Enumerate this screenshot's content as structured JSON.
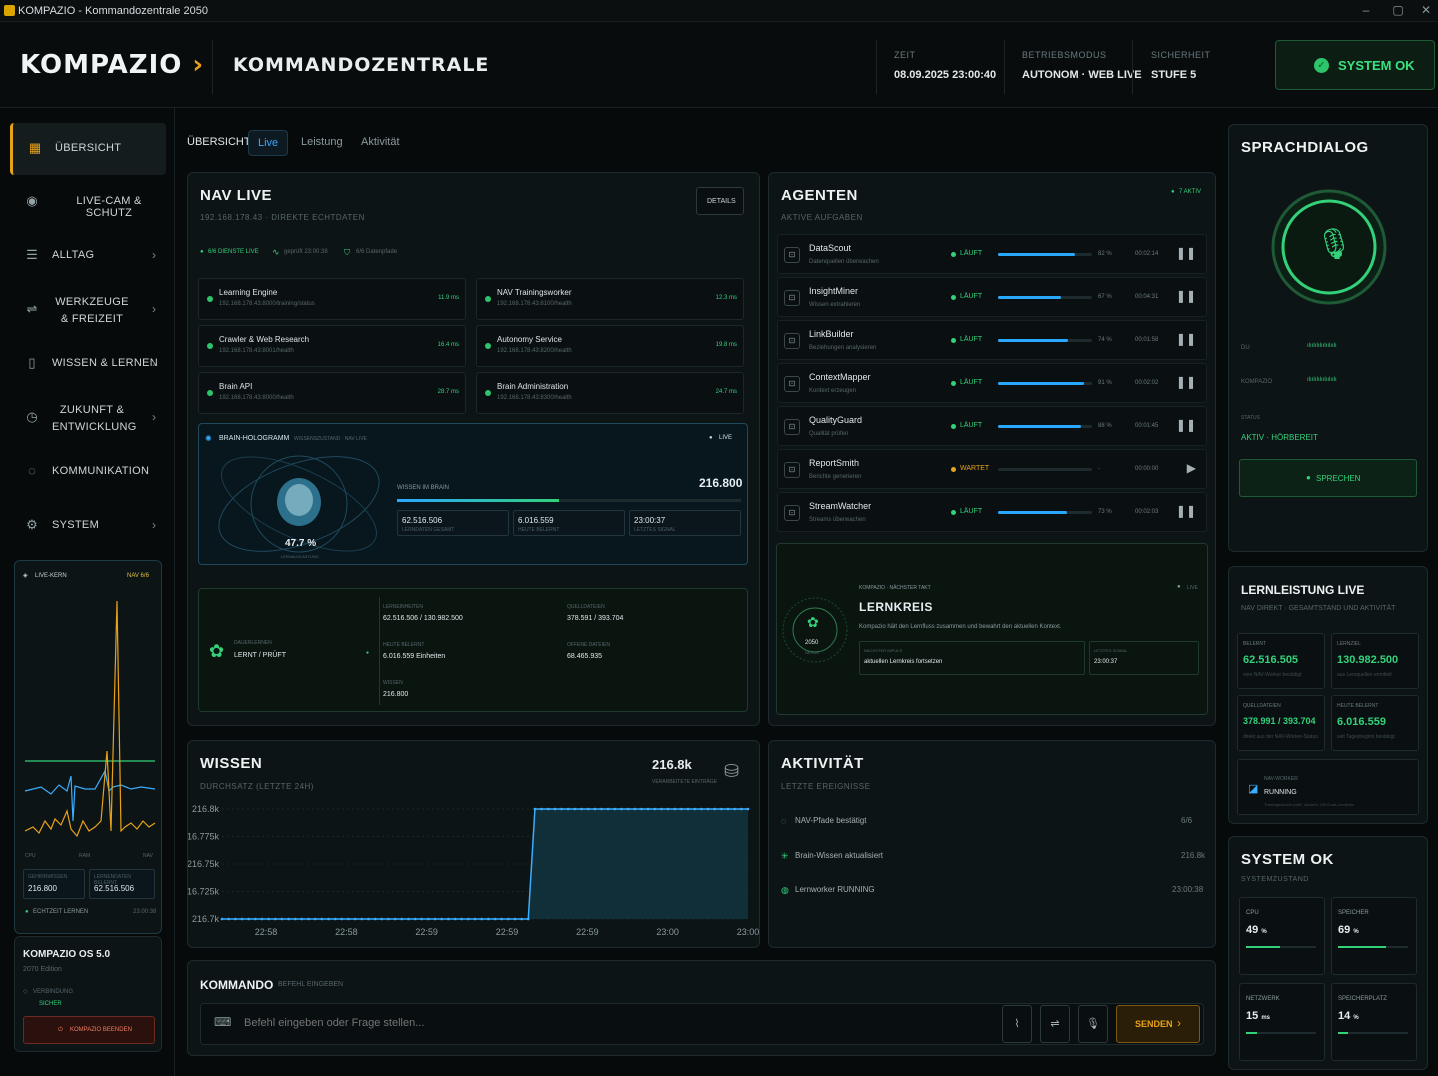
{
  "window": {
    "title": "KOMPAZIO - Kommandozentrale 2050",
    "min": "–",
    "max": "▢",
    "close": "✕"
  },
  "header": {
    "brand": "KOMPAZIO",
    "brand_chevron": "›",
    "page_title": "KOMMANDOZENTRALE",
    "zeit_label": "ZEIT",
    "zeit_value": "08.09.2025 23:00:40",
    "modus_label": "BETRIEBSMODUS",
    "modus_value": "AUTONOM · WEB LIVE",
    "sicherheit_label": "SICHERHEIT",
    "sicherheit_value": "STUFE 5",
    "status_badge": "SYSTEM OK"
  },
  "sidebar": {
    "items": [
      {
        "label": "ÜBERSICHT",
        "icon": "grid-icon"
      },
      {
        "label": "LIVE-CAM & SCHUTZ",
        "icon": "eye-icon"
      },
      {
        "label": "ALLTAG",
        "icon": "list-icon"
      },
      {
        "label": "WERKZEUGE & FREIZEIT",
        "icon": "sliders-icon"
      },
      {
        "label": "WISSEN & LERNEN",
        "icon": "book-icon"
      },
      {
        "label": "ZUKUNFT & ENTWICKLUNG",
        "icon": "clock-icon"
      },
      {
        "label": "KOMMUNIKATION",
        "icon": "chat-icon"
      },
      {
        "label": "SYSTEM",
        "icon": "gear-icon"
      }
    ],
    "livekern": {
      "title": "LIVE-KERN",
      "status": "NAV 6/6",
      "axis": [
        "CPU",
        "RAM",
        "NAV"
      ],
      "left_label": "GEHIRNWISSEN",
      "left_value": "216.800",
      "right_label": "LERNENDATEN BELERNT",
      "right_value": "62.516.506",
      "footer_left": "ECHTZEIT LERNEN",
      "footer_right": "23:00:38"
    },
    "os": {
      "title": "KOMPAZIO OS 5.0",
      "edition": "2070 Edition",
      "conn_label": "VERBINDUNG",
      "conn_value": "SICHER",
      "exit_button": "KOMPAZIO BEENDEN"
    }
  },
  "tabs": {
    "section": "ÜBERSICHT",
    "items": [
      "Live",
      "Leistung",
      "Aktivität"
    ],
    "active": "Live"
  },
  "navlive": {
    "title": "NAV LIVE",
    "subtitle": "192.168.178.43 · DIREKTE ECHTDATEN",
    "details_button": "DETAILS",
    "status_dienste": "6/6 DIENSTE LIVE",
    "status_geprueft": "geprüft 23:00:38",
    "status_pfade": "6/6 Datenpfade",
    "services": [
      {
        "name": "Learning Engine",
        "url": "192.168.178.43:8000/training/status",
        "ms": "11.9 ms"
      },
      {
        "name": "NAV Trainingsworker",
        "url": "192.168.178.43:8100/health",
        "ms": "12.3 ms"
      },
      {
        "name": "Crawler & Web Research",
        "url": "192.168.178.43:8001/health",
        "ms": "16.4 ms"
      },
      {
        "name": "Autonomy Service",
        "url": "192.168.178.43:8200/health",
        "ms": "19.8 ms"
      },
      {
        "name": "Brain API",
        "url": "192.168.178.43:8000/health",
        "ms": "28.7 ms"
      },
      {
        "name": "Brain Administration",
        "url": "192.168.178.43:8300/health",
        "ms": "24.7 ms"
      }
    ],
    "hologram": {
      "title": "BRAIN-HOLOGRAMM",
      "subtitle": "WISSENSZUSTAND · NAV LIVE",
      "live": "LIVE",
      "percent": "47.7 %",
      "percent_label": "LERNAUSLASTUNG",
      "wissen_label": "WISSEN IM BRAIN",
      "wissen_value": "216.800",
      "wissen_fill": 0.47,
      "stats": [
        {
          "v": "62.516.506",
          "l": "LERNDATEN GESAMT"
        },
        {
          "v": "6.016.559",
          "l": "HEUTE BELERNT"
        },
        {
          "v": "23:00:37",
          "l": "LETZTES SIGNAL"
        }
      ]
    },
    "dauerlernen": {
      "label": "DAUERLERNEN",
      "value": "LERNT / PRÜFT",
      "fields": [
        {
          "l": "LERNEINHEITEN",
          "v": "62.516.506 / 130.982.500"
        },
        {
          "l": "QUELLDATEIEN",
          "v": "378.591 / 393.704"
        },
        {
          "l": "HEUTE BELERNT",
          "v": "6.016.559 Einheiten"
        },
        {
          "l": "OFFENE DATEIEN",
          "v": "68.465.935"
        },
        {
          "l": "WISSEN",
          "v": "216.800"
        }
      ]
    }
  },
  "agenten": {
    "title": "AGENTEN",
    "subtitle": "AKTIVE AUFGABEN",
    "active": "7 AKTIV",
    "items": [
      {
        "name": "DataScout",
        "desc": "Datenquellen überwachen",
        "status": "LÄUFT",
        "pct": 82,
        "pct_label": "82 %",
        "time": "00:02:14",
        "ctl": "❚❚"
      },
      {
        "name": "InsightMiner",
        "desc": "Wissen extrahieren",
        "status": "LÄUFT",
        "pct": 67,
        "pct_label": "67 %",
        "time": "00:04:31",
        "ctl": "❚❚"
      },
      {
        "name": "LinkBuilder",
        "desc": "Beziehungen analysieren",
        "status": "LÄUFT",
        "pct": 74,
        "pct_label": "74 %",
        "time": "00:01:58",
        "ctl": "❚❚"
      },
      {
        "name": "ContextMapper",
        "desc": "Kontext erzeugen",
        "status": "LÄUFT",
        "pct": 91,
        "pct_label": "91 %",
        "time": "00:02:02",
        "ctl": "❚❚"
      },
      {
        "name": "QualityGuard",
        "desc": "Qualität prüfen",
        "status": "LÄUFT",
        "pct": 88,
        "pct_label": "88 %",
        "time": "00:01:45",
        "ctl": "❚❚"
      },
      {
        "name": "ReportSmith",
        "desc": "Berichte generieren",
        "status": "WARTET",
        "pct": 0,
        "pct_label": "-",
        "time": "00:00:00",
        "ctl": "▶"
      },
      {
        "name": "StreamWatcher",
        "desc": "Streams überwachen",
        "status": "LÄUFT",
        "pct": 73,
        "pct_label": "73 %",
        "time": "00:02:03",
        "ctl": "❚❚"
      }
    ]
  },
  "lernkreis": {
    "kicker": "KOMPAZIO · NÄCHSTER TAKT",
    "live": "LIVE",
    "title": "LERNKREIS",
    "text": "Kompazio hält den Lernfluss zusammen und bewahrt den aktuellen Kontext.",
    "year": "2050",
    "year_label": "NEXUS",
    "next_label": "NÄCHSTER IMPULS",
    "next_value": "aktuellen Lernkreis fortsetzen",
    "signal_label": "LETZTES SIGNAL",
    "signal_value": "23:00:37"
  },
  "wissen": {
    "title": "WISSEN",
    "subtitle": "DURCHSATZ (LETZTE 24H)",
    "total": "216.8k",
    "total_label": "VERARBEITETE EINTRÄGE"
  },
  "chart_data": {
    "type": "area",
    "x": [
      "22:58",
      "22:58",
      "22:59",
      "22:59",
      "22:59",
      "23:00",
      "23:00"
    ],
    "y_ticks": [
      "216.8k",
      "216.775k",
      "216.75k",
      "216.725k",
      "216.7k"
    ],
    "ylim": [
      216700,
      216800
    ],
    "values": [
      216700,
      216700,
      216700,
      216700,
      216700,
      216700,
      216700,
      216700,
      216700,
      216700,
      216700,
      216700,
      216700,
      216700,
      216700,
      216700,
      216700,
      216700,
      216700,
      216700,
      216700,
      216700,
      216700,
      216700,
      216700,
      216700,
      216700,
      216700,
      216700,
      216700,
      216700,
      216700,
      216700,
      216700,
      216700,
      216700,
      216700,
      216700,
      216700,
      216700,
      216700,
      216700,
      216700,
      216700,
      216700,
      216700,
      216700,
      216800,
      216800,
      216800,
      216800,
      216800,
      216800,
      216800,
      216800,
      216800,
      216800,
      216800,
      216800,
      216800,
      216800,
      216800,
      216800,
      216800,
      216800,
      216800,
      216800,
      216800,
      216800,
      216800,
      216800,
      216800,
      216800,
      216800,
      216800,
      216800,
      216800,
      216800,
      216800,
      216800
    ],
    "color": "#3aaeff"
  },
  "aktivitaet": {
    "title": "AKTIVITÄT",
    "subtitle": "LETZTE EREIGNISSE",
    "items": [
      {
        "text": "NAV-Pfade bestätigt",
        "value": "6/6"
      },
      {
        "text": "Brain-Wissen aktualisiert",
        "value": "216.8k"
      },
      {
        "text": "Lernworker RUNNING",
        "value": "23:00:38"
      }
    ]
  },
  "kommando": {
    "title": "KOMMANDO",
    "subtitle": "BEFEHL EINGEBEN",
    "placeholder": "Befehl eingeben oder Frage stellen...",
    "send": "SENDEN"
  },
  "sprachdialog": {
    "title": "SPRACHDIALOG",
    "ch1": "DU",
    "ch2": "KOMPAZIO",
    "status_label": "STATUS",
    "status_value": "AKTIV · HÖRBEREIT",
    "button": "SPRECHEN"
  },
  "lernleistung": {
    "title": "LERNLEISTUNG LIVE",
    "subtitle": "NAV DIREKT · GESAMTSTAND UND AKTIVITÄT",
    "kpis": [
      {
        "l": "BELERNT",
        "v": "62.516.505",
        "s": "vom NAV-Worker bestätigt"
      },
      {
        "l": "LERNZIEL",
        "v": "130.982.500",
        "s": "aus Lernquellen ermittelt"
      },
      {
        "l": "QUELLDATEIEN",
        "v": "378.991 / 393.704",
        "s": "direkt aus der NAV-Worker-Status"
      },
      {
        "l": "HEUTE BELERNT",
        "v": "6.016.559",
        "s": "seit Tagesbeginn bestätigt"
      }
    ],
    "worker_label": "NAV-WORKER",
    "worker_value": "RUNNING",
    "worker_text": "Trainingsworker prüft, ob/sieht, 1/8 Chart-Lernkreis"
  },
  "systemok": {
    "title": "SYSTEM OK",
    "subtitle": "SYSTEMZUSTAND",
    "metrics": [
      {
        "l": "CPU",
        "v": "49",
        "u": "%",
        "fill": 0.49
      },
      {
        "l": "SPEICHER",
        "v": "69",
        "u": "%",
        "fill": 0.69
      },
      {
        "l": "NETZWERK",
        "v": "15",
        "u": "ms",
        "fill": 0.15
      },
      {
        "l": "SPEICHERPLATZ",
        "v": "14",
        "u": "%",
        "fill": 0.14
      }
    ]
  }
}
